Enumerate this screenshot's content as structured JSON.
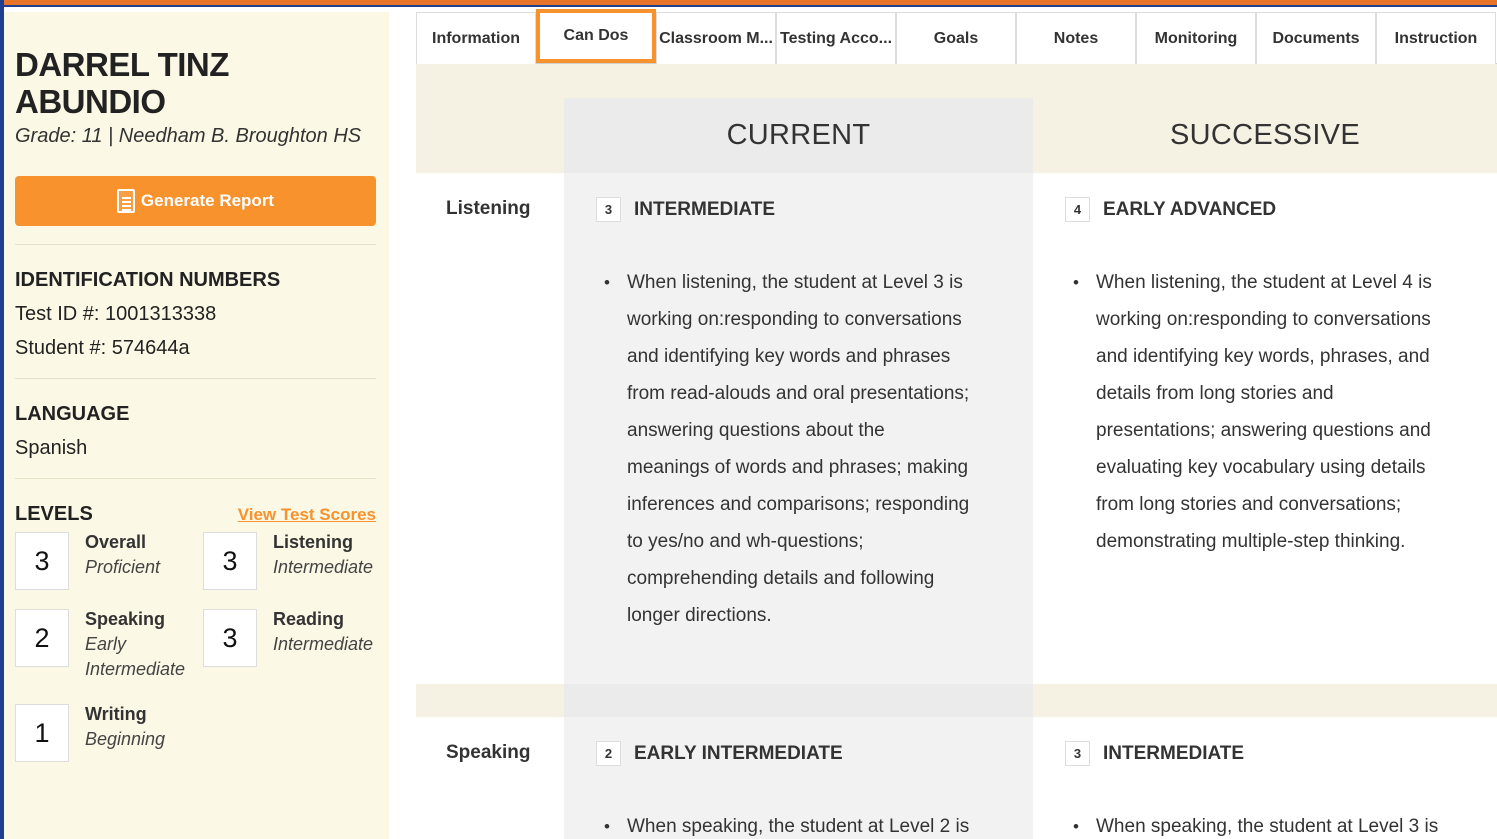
{
  "student": {
    "name_line1": "DARREL TINZ",
    "name_line2": "ABUNDIO",
    "grade_school": "Grade: 11 | Needham B. Broughton HS"
  },
  "report_button": {
    "label": "Generate Report",
    "icon": "document-icon"
  },
  "identification": {
    "title": "IDENTIFICATION NUMBERS",
    "test_id": "Test ID #: 1001313338",
    "student_no": "Student #: 574644a"
  },
  "language": {
    "title": "LANGUAGE",
    "value": "Spanish"
  },
  "levels": {
    "title": "LEVELS",
    "view_link": "View Test Scores",
    "items": [
      {
        "value": "3",
        "name": "Overall",
        "desc": "Proficient"
      },
      {
        "value": "3",
        "name": "Listening",
        "desc": "Intermediate"
      },
      {
        "value": "2",
        "name": "Speaking",
        "desc": "Early Intermediate"
      },
      {
        "value": "3",
        "name": "Reading",
        "desc": "Intermediate"
      },
      {
        "value": "1",
        "name": "Writing",
        "desc": "Beginning"
      }
    ]
  },
  "tabs": [
    {
      "label": "Information"
    },
    {
      "label": "Can Dos"
    },
    {
      "label": "Classroom M..."
    },
    {
      "label": "Testing Acco..."
    },
    {
      "label": "Goals"
    },
    {
      "label": "Notes"
    },
    {
      "label": "Monitoring"
    },
    {
      "label": "Documents"
    },
    {
      "label": "Instruction"
    }
  ],
  "columns": {
    "current": "CURRENT",
    "successive": "SUCCESSIVE"
  },
  "rows": [
    {
      "skill": "Listening",
      "current": {
        "level": "3",
        "title": "INTERMEDIATE",
        "lines": [
          "When listening, the student at Level 3 is",
          "working on:responding to conversations",
          "and identifying key words and phrases",
          "from read-alouds and oral presentations;",
          "answering questions about the",
          "meanings of words and phrases; making",
          "inferences and comparisons; responding",
          "to yes/no and wh-questions;",
          "comprehending details and following",
          "longer directions."
        ]
      },
      "successive": {
        "level": "4",
        "title": "EARLY ADVANCED",
        "lines": [
          "When listening, the student at Level 4 is",
          "working on:responding to conversations",
          "and identifying key words, phrases, and",
          "details from long stories and",
          "presentations; answering questions and",
          "evaluating key vocabulary using details",
          "from long stories and conversations;",
          "demonstrating multiple-step thinking."
        ]
      }
    },
    {
      "skill": "Speaking",
      "current": {
        "level": "2",
        "title": "EARLY INTERMEDIATE",
        "lines": [
          "When speaking, the student at Level 2 is"
        ]
      },
      "successive": {
        "level": "3",
        "title": "INTERMEDIATE",
        "lines": [
          "When speaking, the student at Level 3 is"
        ]
      }
    }
  ],
  "colors": {
    "accent": "#f7922d",
    "sidebar_bg": "#fbf8e6",
    "current_col_bg": "#ebebeb",
    "content_bg": "#f5f2e4"
  }
}
